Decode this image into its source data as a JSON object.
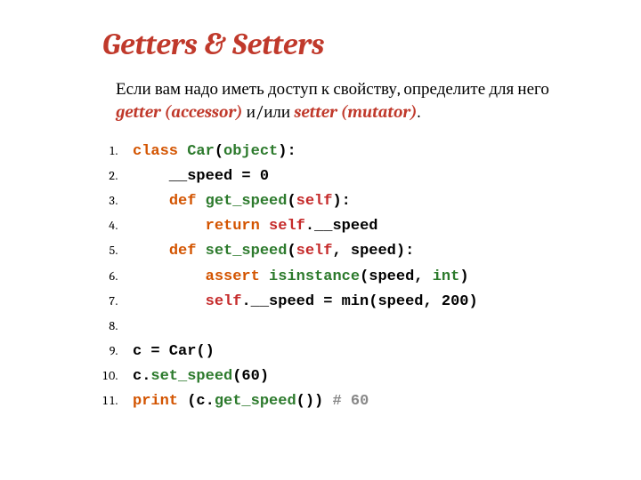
{
  "title": "Getters & Setters",
  "desc": {
    "part1": "Если вам надо иметь доступ к свойству, определите для него ",
    "h1": "getter (accessor)",
    "part2": " и/или ",
    "h2": "setter (mutator)",
    "part3": "."
  },
  "code": {
    "l1": {
      "kw": "class",
      "sp": " ",
      "cls": "Car",
      "p1": "(",
      "obj": "object",
      "p2": "):"
    },
    "l2": {
      "txt": "    __speed = 0"
    },
    "l3": {
      "ind": "    ",
      "kw": "def",
      "sp": " ",
      "fn": "get_speed",
      "p1": "(",
      "self": "self",
      "p2": "):"
    },
    "l4": {
      "ind": "        ",
      "kw": "return",
      "sp": " ",
      "self": "self",
      "tail": ".__speed"
    },
    "l5": {
      "ind": "    ",
      "kw": "def",
      "sp": " ",
      "fn": "set_speed",
      "p1": "(",
      "self": "self",
      "rest": ", speed):"
    },
    "l6": {
      "ind": "        ",
      "kw": "assert",
      "sp": " ",
      "fn": "isinstance",
      "p1": "(speed, ",
      "typ": "int",
      "p2": ")"
    },
    "l7": {
      "ind": "        ",
      "self": "self",
      "tail": ".__speed = min(speed, 200)"
    },
    "l8": {
      "txt": " "
    },
    "l9": {
      "txt": "c = Car()"
    },
    "l10": {
      "pre": "c.",
      "fn": "set_speed",
      "tail": "(60)"
    },
    "l11": {
      "kw": "print",
      "sp": " ",
      "pre": "(c.",
      "fn": "get_speed",
      "tail": "()) ",
      "cmt": "# 60"
    }
  }
}
